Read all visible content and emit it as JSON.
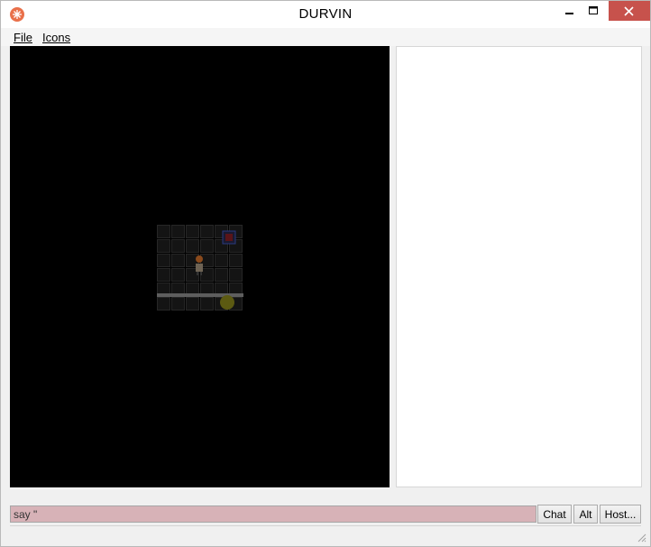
{
  "window": {
    "title": "DURVIN"
  },
  "menu": {
    "file_label": "File",
    "icons_label": "Icons"
  },
  "input": {
    "value": "say \""
  },
  "buttons": {
    "chat": "Chat",
    "alt": "Alt",
    "host": "Host..."
  },
  "colors": {
    "close_button": "#c7524c",
    "input_background": "#d7b2b7",
    "game_background": "#000000",
    "app_icon": "#e9704a"
  },
  "icons": [
    "app-icon",
    "minimize-icon",
    "maximize-icon",
    "close-icon",
    "resize-grip-icon"
  ]
}
